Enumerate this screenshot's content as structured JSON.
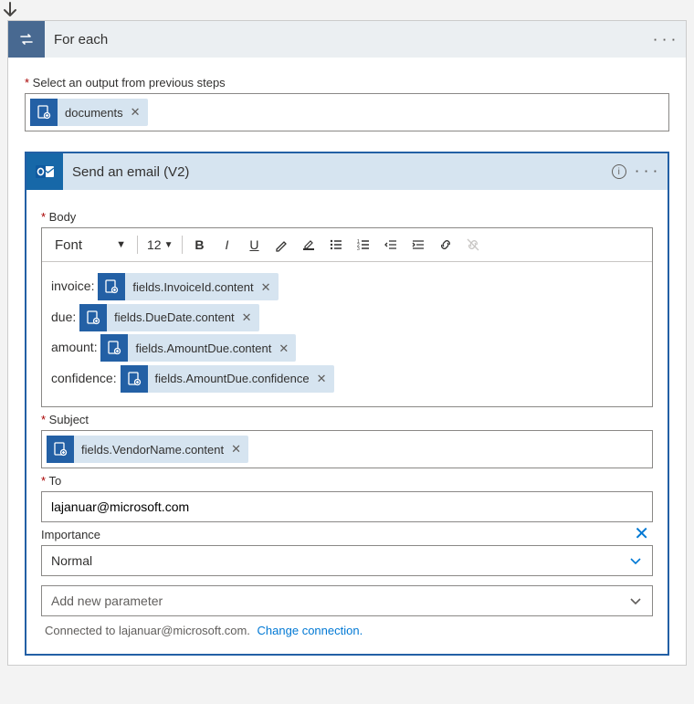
{
  "foreach": {
    "title": "For each",
    "select_label": "Select an output from previous steps",
    "token": "documents"
  },
  "email": {
    "title": "Send an email (V2)",
    "body_label": "Body",
    "font": "Font",
    "font_size": "12",
    "lines": {
      "invoice": {
        "prefix": "invoice: ",
        "token": "fields.InvoiceId.content"
      },
      "due": {
        "prefix": "due: ",
        "token": "fields.DueDate.content"
      },
      "amount": {
        "prefix": "amount: ",
        "token": "fields.AmountDue.content"
      },
      "confidence": {
        "prefix": "confidence: ",
        "token": "fields.AmountDue.confidence"
      }
    },
    "subject_label": "Subject",
    "subject_token": "fields.VendorName.content",
    "to_label": "To",
    "to_value": "lajanuar@microsoft.com",
    "importance_label": "Importance",
    "importance_value": "Normal",
    "add_param": "Add new parameter",
    "connected_text": "Connected to lajanuar@microsoft.com.",
    "change_conn": "Change connection."
  }
}
